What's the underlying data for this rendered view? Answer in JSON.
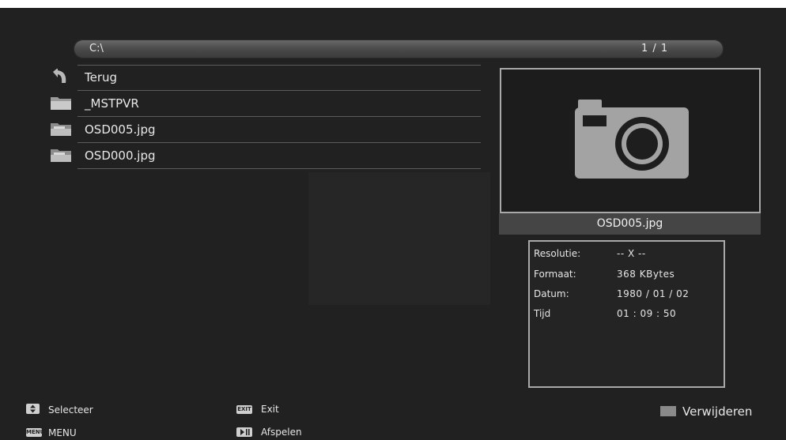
{
  "path_bar": {
    "path": "C:\\",
    "page": "1 / 1"
  },
  "files": [
    {
      "label": "Terug",
      "icon": "back-arrow-icon"
    },
    {
      "label": "_MSTPVR",
      "icon": "folder-icon"
    },
    {
      "label": "OSD005.jpg",
      "icon": "photo-file-icon"
    },
    {
      "label": "OSD000.jpg",
      "icon": "photo-file-icon"
    }
  ],
  "preview": {
    "icon": "camera-icon",
    "filename": "OSD005.jpg"
  },
  "info": {
    "rows": [
      {
        "key": "Resolutie:",
        "value": "-- X --"
      },
      {
        "key": "Formaat:",
        "value": "368 KBytes"
      },
      {
        "key": "Datum:",
        "value": "1980 / 01 / 02"
      },
      {
        "key": "Tijd",
        "value": "01 : 09 : 50"
      }
    ]
  },
  "footer": {
    "select_key": "",
    "select_label": "Selecteer",
    "menu_key": "MENU",
    "menu_label": "MENU",
    "exit_key": "EXIT",
    "exit_label": "Exit",
    "play_label": "Afspelen",
    "delete_label": "Verwijderen",
    "delete_color": "#8a8a8a"
  }
}
